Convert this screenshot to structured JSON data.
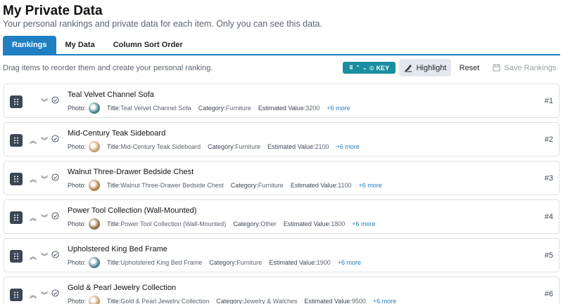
{
  "header": {
    "title": "My Private Data",
    "subtitle": "Your personal rankings and private data for each item. Only you can see this data."
  },
  "tabs": [
    {
      "label": "Rankings",
      "active": true
    },
    {
      "label": "My Data",
      "active": false
    },
    {
      "label": "Column Sort Order",
      "active": false
    }
  ],
  "toolbar": {
    "instructions": "Drag items to reorder them and create your personal ranking.",
    "key_label": "KEY",
    "highlight_label": "Highlight",
    "reset_label": "Reset",
    "save_label": "Save Rankings"
  },
  "labels": {
    "photo": "Photo:",
    "title": "Title:",
    "category": "Category:",
    "estimated_value": "Estimated Value:"
  },
  "colors": {
    "accent": "#1f7fc1",
    "key_badge": "#1a8ea0",
    "drag_handle": "#3c4656"
  },
  "items": [
    {
      "name": "Teal Velvet Channel Sofa",
      "title": "Teal Velvet Channel Sofa",
      "category": "Furniture",
      "value": "3200",
      "more": "+6 more",
      "rank": "#1",
      "thumb": "#3f7f86"
    },
    {
      "name": "Mid-Century Teak Sideboard",
      "title": "Mid-Century Teak Sideboard",
      "category": "Furniture",
      "value": "2100",
      "more": "+6 more",
      "rank": "#2",
      "thumb": "#c89b6a"
    },
    {
      "name": "Walnut Three-Drawer Bedside Chest",
      "title": "Walnut Three-Drawer Bedside Chest",
      "category": "Furniture",
      "value": "1100",
      "more": "+6 more",
      "rank": "#3",
      "thumb": "#b07a43"
    },
    {
      "name": "Power Tool Collection (Wall-Mounted)",
      "title": "Power Tool Collection (Wall-Mounted)",
      "category": "Other",
      "value": "1800",
      "more": "+6 more",
      "rank": "#4",
      "thumb": "#8a6a3b"
    },
    {
      "name": "Upholstered King Bed Frame",
      "title": "Upholstered King Bed Frame",
      "category": "Furniture",
      "value": "1900",
      "more": "+6 more",
      "rank": "#5",
      "thumb": "#4d7f8c"
    },
    {
      "name": "Gold & Pearl Jewelry Collection",
      "title": "Gold & Pearl Jewelry Collection",
      "category": "Jewelry & Watches",
      "value": "9500",
      "more": "+6 more",
      "rank": "#6",
      "thumb": "#c7a06a"
    }
  ]
}
